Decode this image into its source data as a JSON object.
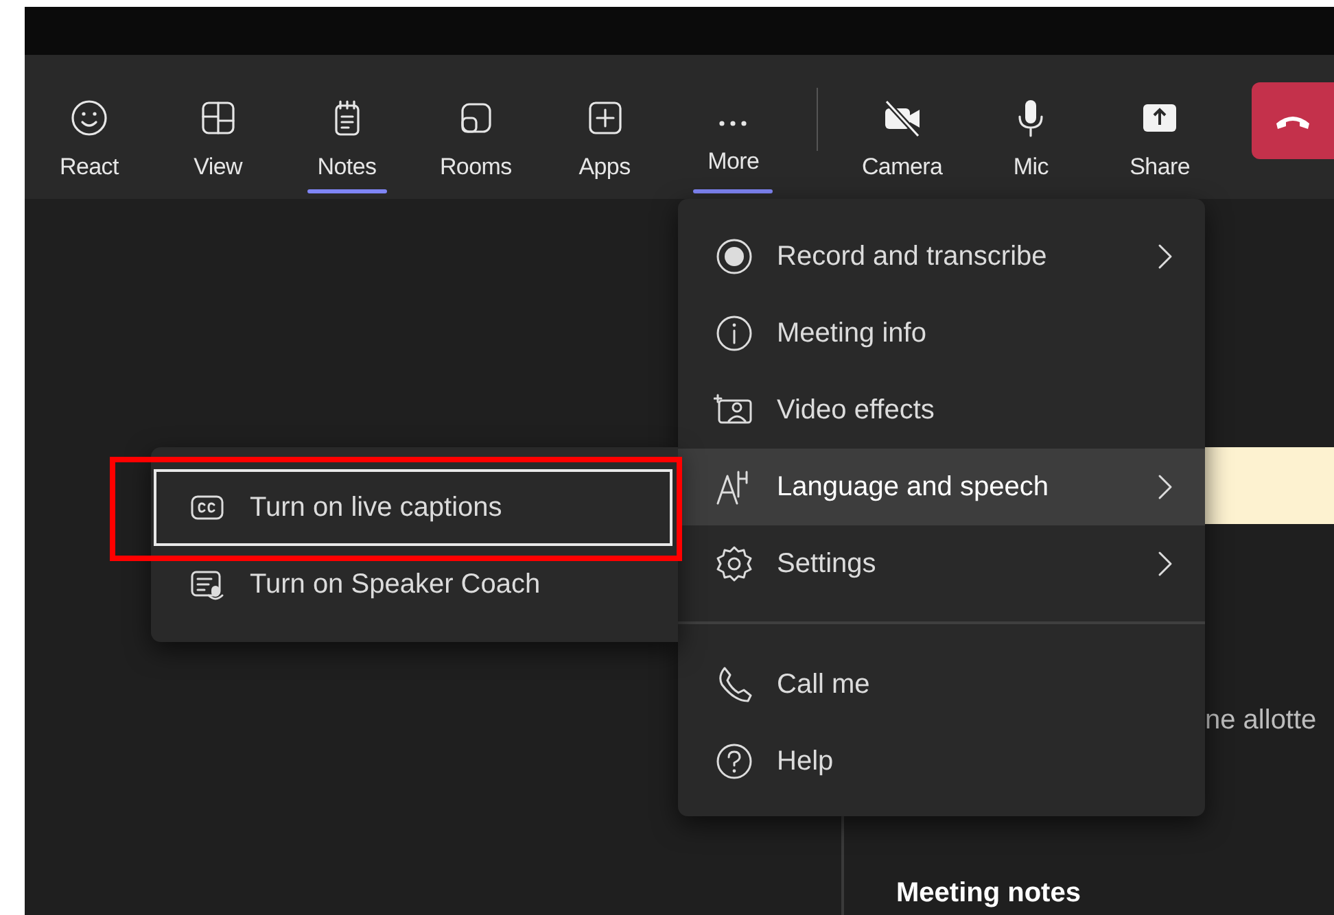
{
  "toolbar": [
    {
      "label": "React",
      "selected": false
    },
    {
      "label": "View",
      "selected": false
    },
    {
      "label": "Notes",
      "selected": true
    },
    {
      "label": "Rooms",
      "selected": false
    },
    {
      "label": "Apps",
      "selected": false
    },
    {
      "label": "More",
      "selected": true
    },
    {
      "label": "Camera",
      "selected": false
    },
    {
      "label": "Mic",
      "selected": false
    },
    {
      "label": "Share",
      "selected": false
    }
  ],
  "more_menu": {
    "items": [
      {
        "label": "Record and transcribe",
        "submenu": true,
        "selected": false
      },
      {
        "label": "Meeting info",
        "submenu": false,
        "selected": false
      },
      {
        "label": "Video effects",
        "submenu": false,
        "selected": false
      },
      {
        "label": "Language and speech",
        "submenu": true,
        "selected": true
      },
      {
        "label": "Settings",
        "submenu": true,
        "selected": false
      },
      {
        "label": "Call me",
        "submenu": false,
        "selected": false
      },
      {
        "label": "Help",
        "submenu": false,
        "selected": false
      }
    ]
  },
  "language_submenu": {
    "items": [
      {
        "label": "Turn on live captions",
        "focused": true,
        "highlighted": true
      },
      {
        "label": "Turn on Speaker Coach",
        "focused": false,
        "highlighted": false
      }
    ]
  },
  "side_panel": {
    "partial_text": "ne allotte",
    "heading": "Meeting notes"
  }
}
